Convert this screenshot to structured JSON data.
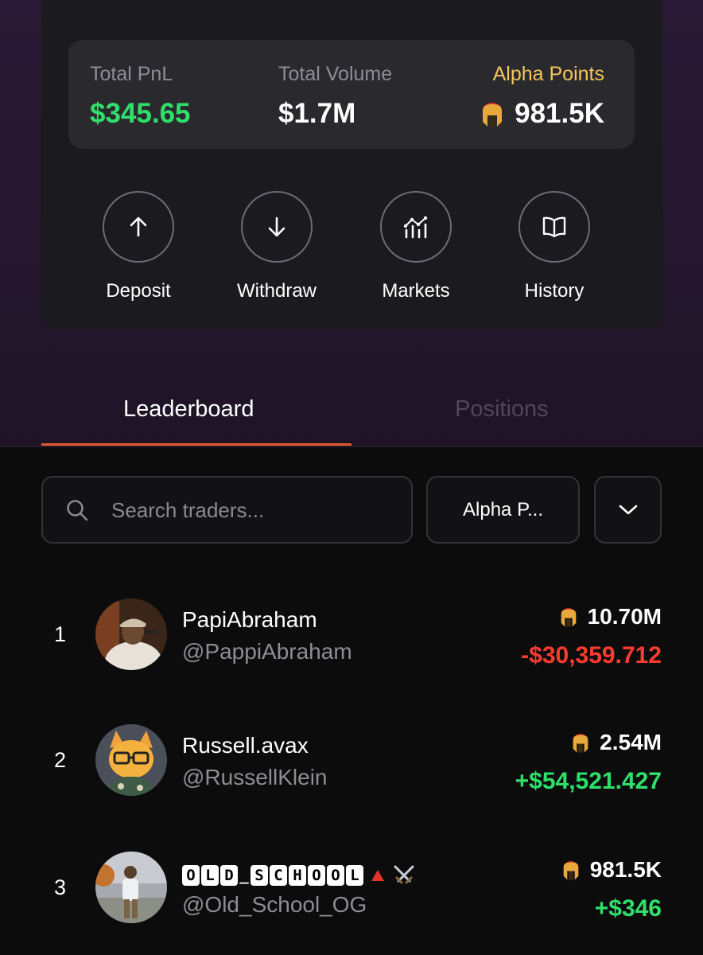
{
  "stats": {
    "total_pnl_label": "Total PnL",
    "total_pnl_value": "$345.65",
    "total_volume_label": "Total Volume",
    "total_volume_value": "$1.7M",
    "alpha_points_label": "Alpha Points",
    "alpha_points_value": "981.5K"
  },
  "actions": {
    "deposit": "Deposit",
    "withdraw": "Withdraw",
    "markets": "Markets",
    "history": "History"
  },
  "tabs": {
    "leaderboard": "Leaderboard",
    "positions": "Positions",
    "active": "Leaderboard"
  },
  "search": {
    "placeholder": "Search traders..."
  },
  "sort": {
    "selected": "Alpha P..."
  },
  "leaderboard": [
    {
      "rank": "1",
      "name": "PapiAbraham",
      "handle": "@PappiAbraham",
      "points": "10.70M",
      "pnl": "-$30,359.712"
    },
    {
      "rank": "2",
      "name": "Russell.avax",
      "handle": "@RussellKlein",
      "points": "2.54M",
      "pnl": "+$54,521.427"
    },
    {
      "rank": "3",
      "name": "OLD_SCHOOL",
      "handle": "@Old_School_OG",
      "points": "981.5K",
      "pnl": "+$346"
    }
  ],
  "colors": {
    "positive": "#2ee06a",
    "negative": "#ff3b2f",
    "accent": "#e2572b",
    "alpha_label": "#f3c75a"
  },
  "icons": {
    "points": "spartan-helmet-icon",
    "search": "search-icon",
    "dropdown": "chevron-down-icon"
  }
}
